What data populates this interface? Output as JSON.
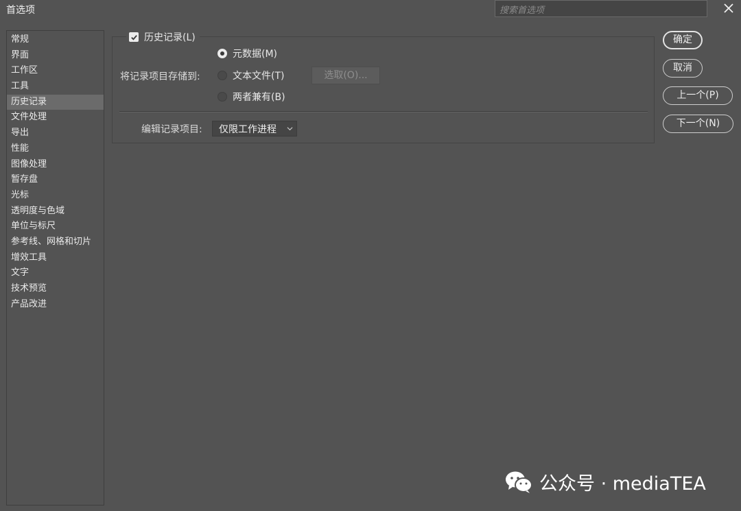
{
  "window": {
    "title": "首选项"
  },
  "search": {
    "placeholder": "搜索首选项"
  },
  "sidebar": {
    "items": [
      {
        "label": "常规"
      },
      {
        "label": "界面"
      },
      {
        "label": "工作区"
      },
      {
        "label": "工具"
      },
      {
        "label": "历史记录",
        "active": true
      },
      {
        "label": "文件处理"
      },
      {
        "label": "导出"
      },
      {
        "label": "性能"
      },
      {
        "label": "图像处理"
      },
      {
        "label": "暂存盘"
      },
      {
        "label": "光标"
      },
      {
        "label": "透明度与色域"
      },
      {
        "label": "单位与标尺"
      },
      {
        "label": "参考线、网格和切片"
      },
      {
        "label": "增效工具"
      },
      {
        "label": "文字"
      },
      {
        "label": "技术预览"
      },
      {
        "label": "产品改进"
      }
    ]
  },
  "history": {
    "enabled_label": "历史记录(L)",
    "enabled": true,
    "store_label": "将记录项目存储到:",
    "options": [
      {
        "label": "元数据(M)",
        "selected": true
      },
      {
        "label": "文本文件(T)",
        "selected": false
      },
      {
        "label": "两者兼有(B)",
        "selected": false
      }
    ],
    "choose_button": "选取(O)...",
    "edit_label": "编辑记录项目:",
    "edit_value": "仅限工作进程"
  },
  "buttons": {
    "ok": "确定",
    "cancel": "取消",
    "prev": "上一个(P)",
    "next": "下一个(N)"
  },
  "watermark": {
    "text": "公众号 · mediaTEA"
  },
  "colors": {
    "background": "#535353",
    "active_item": "#6b6b6b"
  }
}
